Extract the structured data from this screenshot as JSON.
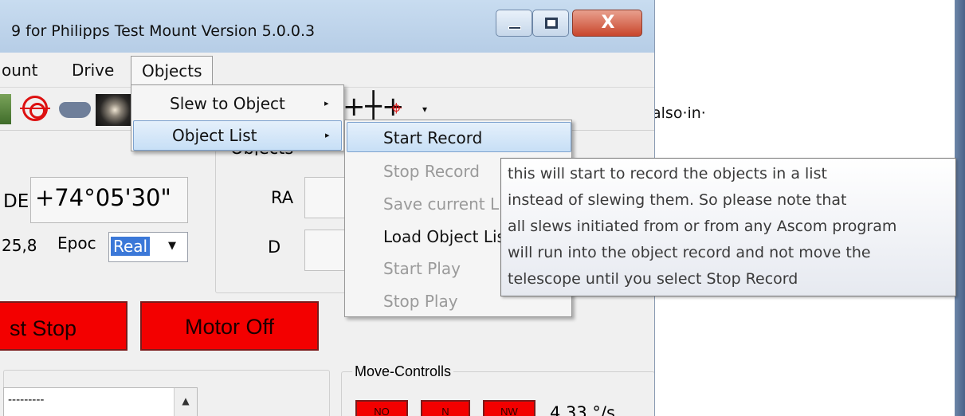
{
  "window": {
    "title": "9 for Philipps Test Mount Version 5.0.0.3",
    "close_glyph": "X"
  },
  "background_doc": {
    "text": "also·in·"
  },
  "menubar": {
    "items": [
      "ount",
      "Drive",
      "Objects"
    ]
  },
  "toolbar": {
    "icons": [
      "target-icon",
      "gamepad-icon",
      "galaxy-icon",
      "crosshair-icon",
      "red-crosshair-icon"
    ],
    "crosshair_glyph": "+┼+",
    "red_crosshair_glyph": "⌖",
    "dropdown_caret": "▾"
  },
  "coords": {
    "de_label": "DE",
    "de_value": "+74°05'30\"",
    "val_partial": "25,8",
    "epoc_label": "Epoc",
    "epoc_value": "Real",
    "select_caret": "▼"
  },
  "objects_panel": {
    "label": "Objects",
    "ra_label": "RA",
    "d_label": "D"
  },
  "buttons": {
    "stop": "st Stop",
    "motor_off": "Motor Off"
  },
  "list": {
    "dashes": "---------",
    "scroll_up": "▲"
  },
  "move_controls": {
    "label": "Move-Controlls",
    "no": "NO",
    "n": "N",
    "nw": "NW",
    "speed": "4,33 °/s"
  },
  "objects_menu": {
    "submenu_arrow": "▸",
    "items": [
      {
        "label": "Slew to Object"
      },
      {
        "label": "Object List"
      }
    ]
  },
  "object_list_menu": {
    "items": [
      {
        "label": "Start Record",
        "enabled": true
      },
      {
        "label": "Stop Record",
        "enabled": false
      },
      {
        "label": "Save current List",
        "enabled": false
      },
      {
        "label": "Load Object List",
        "enabled": true
      },
      {
        "label": "Start Play",
        "enabled": false
      },
      {
        "label": "Stop  Play",
        "enabled": false
      }
    ]
  },
  "tooltip": {
    "lines": [
      "this will start to record the objects in a list",
      "instead of slewing them. So please note that",
      "all slews initiated from or from any Ascom program",
      "will run into the object record and not move the",
      "telescope until you select Stop Record"
    ]
  },
  "colors": {
    "stop_red": "#f30000",
    "highlight_blue": "#c7dff6",
    "selection_blue": "#3b78d8"
  }
}
